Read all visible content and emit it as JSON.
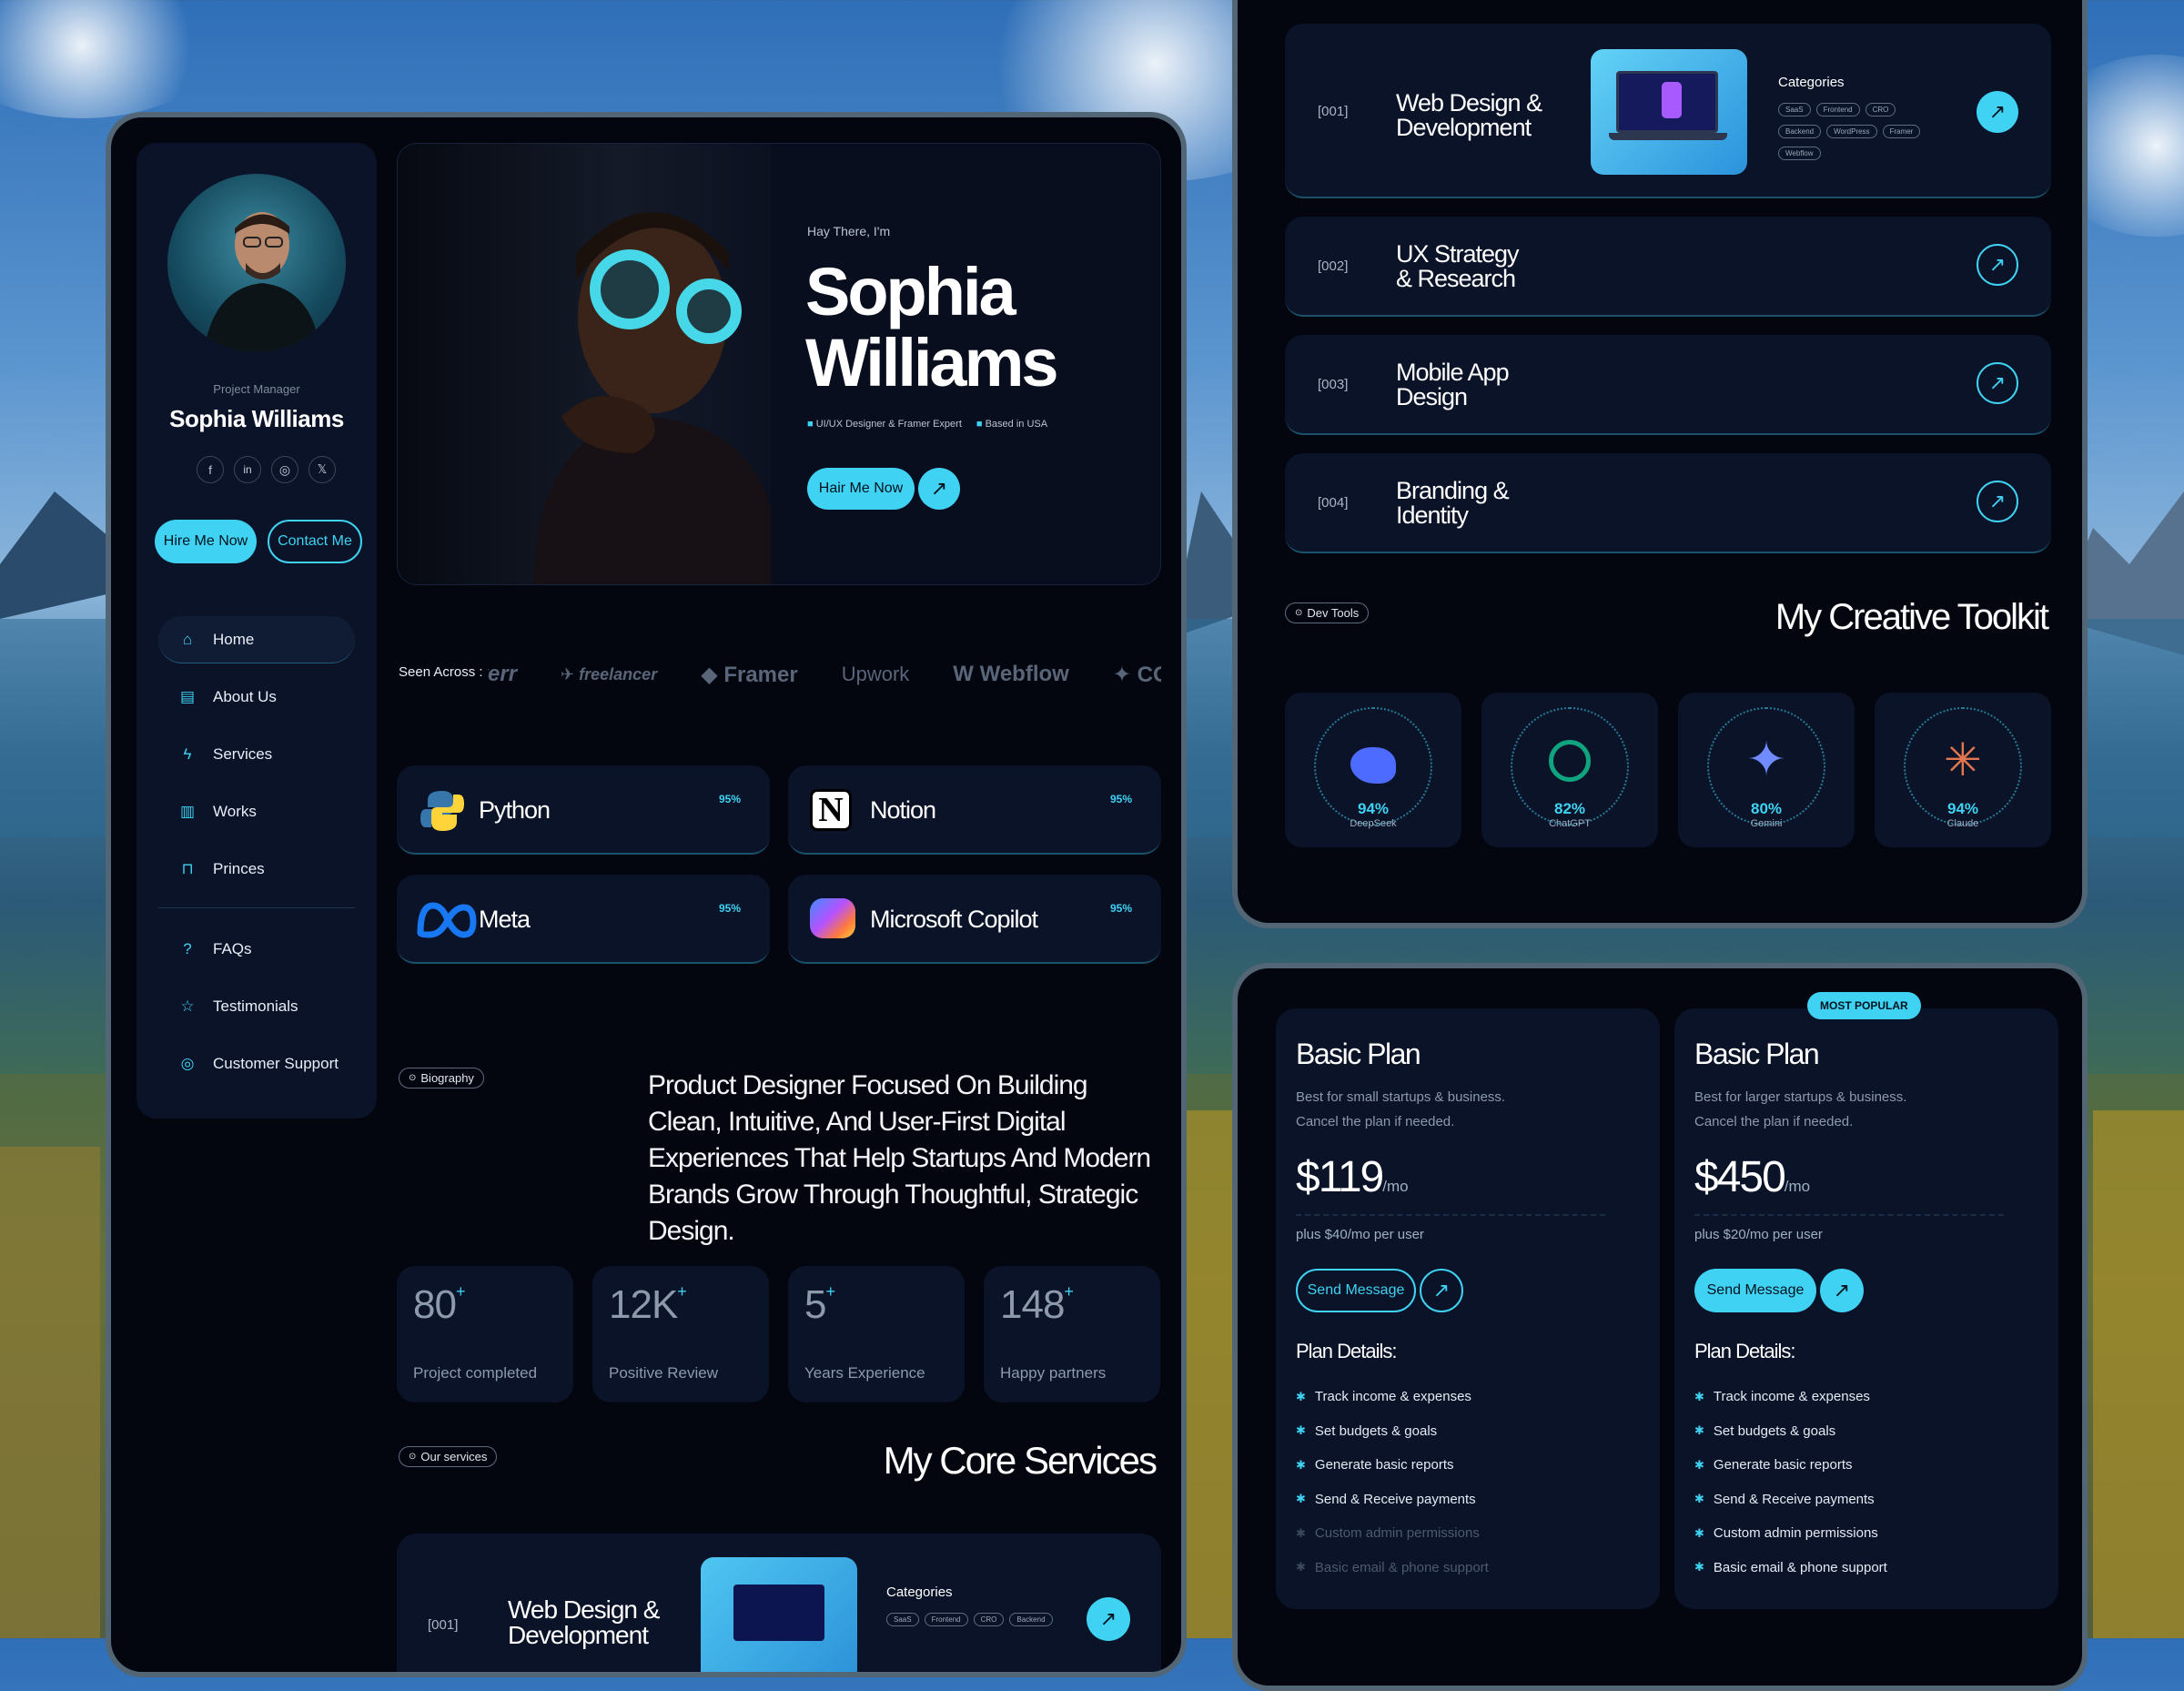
{
  "sidebar": {
    "role": "Project Manager",
    "name": "Sophia Williams",
    "social": [
      {
        "icon": "facebook-icon",
        "glyph": "f"
      },
      {
        "icon": "linkedin-icon",
        "glyph": "in"
      },
      {
        "icon": "dribbble-icon",
        "glyph": "◎"
      },
      {
        "icon": "x-icon",
        "glyph": "𝕏"
      }
    ],
    "hire_label": "Hire Me Now",
    "contact_label": "Contact Me",
    "nav": [
      {
        "label": "Home",
        "icon": "home-icon"
      },
      {
        "label": "About Us",
        "icon": "id-card-icon"
      },
      {
        "label": "Services",
        "icon": "bolt-icon"
      },
      {
        "label": "Works",
        "icon": "folder-icon"
      },
      {
        "label": "Princes",
        "icon": "lock-icon"
      }
    ],
    "nav2": [
      {
        "label": "FAQs",
        "icon": "help-icon"
      },
      {
        "label": "Testimonials",
        "icon": "star-icon"
      },
      {
        "label": "Customer Support",
        "icon": "lifebuoy-icon"
      }
    ]
  },
  "hero": {
    "greeting": "Hay There, I'm",
    "first": "Sophia",
    "last": "Williams",
    "tag1": "UI/UX Designer & Framer Expert",
    "tag2": "Based in USA",
    "cta": "Hair Me Now"
  },
  "seen": {
    "label": "Seen Across :",
    "brands": [
      "iverr",
      "freelancer",
      "Framer",
      "Upwork",
      "Webflow",
      "CO"
    ]
  },
  "skills": [
    {
      "name": "Python",
      "pct": "95%",
      "icon": "python-logo-icon"
    },
    {
      "name": "Notion",
      "pct": "95%",
      "icon": "notion-logo-icon"
    },
    {
      "name": "Meta",
      "pct": "95%",
      "icon": "meta-logo-icon"
    },
    {
      "name": "Microsoft Copilot",
      "pct": "95%",
      "icon": "copilot-logo-icon"
    }
  ],
  "bio": {
    "chip": "Biography",
    "text": "Product Designer Focused On Building Clean, Intuitive, And User-First Digital Experiences That Help Startups And Modern Brands Grow Through Thoughtful, Strategic Design."
  },
  "stats": [
    {
      "n": "80",
      "label": "Project completed"
    },
    {
      "n": "12K",
      "label": "Positive Review"
    },
    {
      "n": "5",
      "label": "Years Experience"
    },
    {
      "n": "148",
      "label": "Happy partners"
    }
  ],
  "stat_plus": "+",
  "core": {
    "chip": "Our services",
    "title": "My Core Services"
  },
  "services": [
    {
      "num": "[001]",
      "title1": "Web Design &",
      "title2": "Development",
      "categories": "Categories",
      "tags": [
        "SaaS",
        "Frontend",
        "CRO",
        "Backend",
        "WordPress",
        "Framer",
        "Webflow"
      ]
    },
    {
      "num": "[002]",
      "title1": "UX Strategy",
      "title2": "& Research"
    },
    {
      "num": "[003]",
      "title1": "Mobile App",
      "title2": "Design"
    },
    {
      "num": "[004]",
      "title1": "Branding &",
      "title2": "Identity"
    }
  ],
  "toolkit": {
    "chip": "Dev Tools",
    "title": "My Creative Toolkit",
    "tools": [
      {
        "name": "DeepSeek",
        "pct": "94%",
        "icon": "deepseek-logo-icon",
        "color": "#4d6bfe"
      },
      {
        "name": "ChatGPT",
        "pct": "82%",
        "icon": "chatgpt-logo-icon",
        "color": "#10a37f"
      },
      {
        "name": "Gemini",
        "pct": "80%",
        "icon": "gemini-logo-icon",
        "color": "#5b8cff"
      },
      {
        "name": "Claude",
        "pct": "94%",
        "icon": "claude-logo-icon",
        "color": "#e2764f"
      }
    ]
  },
  "plans": [
    {
      "badge": "",
      "title": "Basic Plan",
      "desc1": "Best for small startups & business.",
      "desc2": "Cancel the plan if needed.",
      "price": "$119",
      "per": "/mo",
      "extra": "plus $40/mo per user",
      "cta": "Send Message",
      "details": "Plan Details:",
      "features": [
        "Track income & expenses",
        "Set budgets & goals",
        "Generate basic reports",
        "Send & Receive payments",
        "Custom admin permissions",
        "Basic email & phone support"
      ],
      "enabled": 4
    },
    {
      "badge": "MOST POPULAR",
      "title": "Basic Plan",
      "desc1": "Best for larger startups & business.",
      "desc2": "Cancel the plan if needed.",
      "price": "$450",
      "per": "/mo",
      "extra": "plus $20/mo per user",
      "cta": "Send Message",
      "details": "Plan Details:",
      "features": [
        "Track income & expenses",
        "Set budgets & goals",
        "Generate basic reports",
        "Send & Receive payments",
        "Custom admin permissions",
        "Basic email & phone support"
      ],
      "enabled": 6
    }
  ],
  "colors": {
    "accent": "#3fd2f2",
    "panel": "#04060f",
    "card": "#0a1328"
  }
}
